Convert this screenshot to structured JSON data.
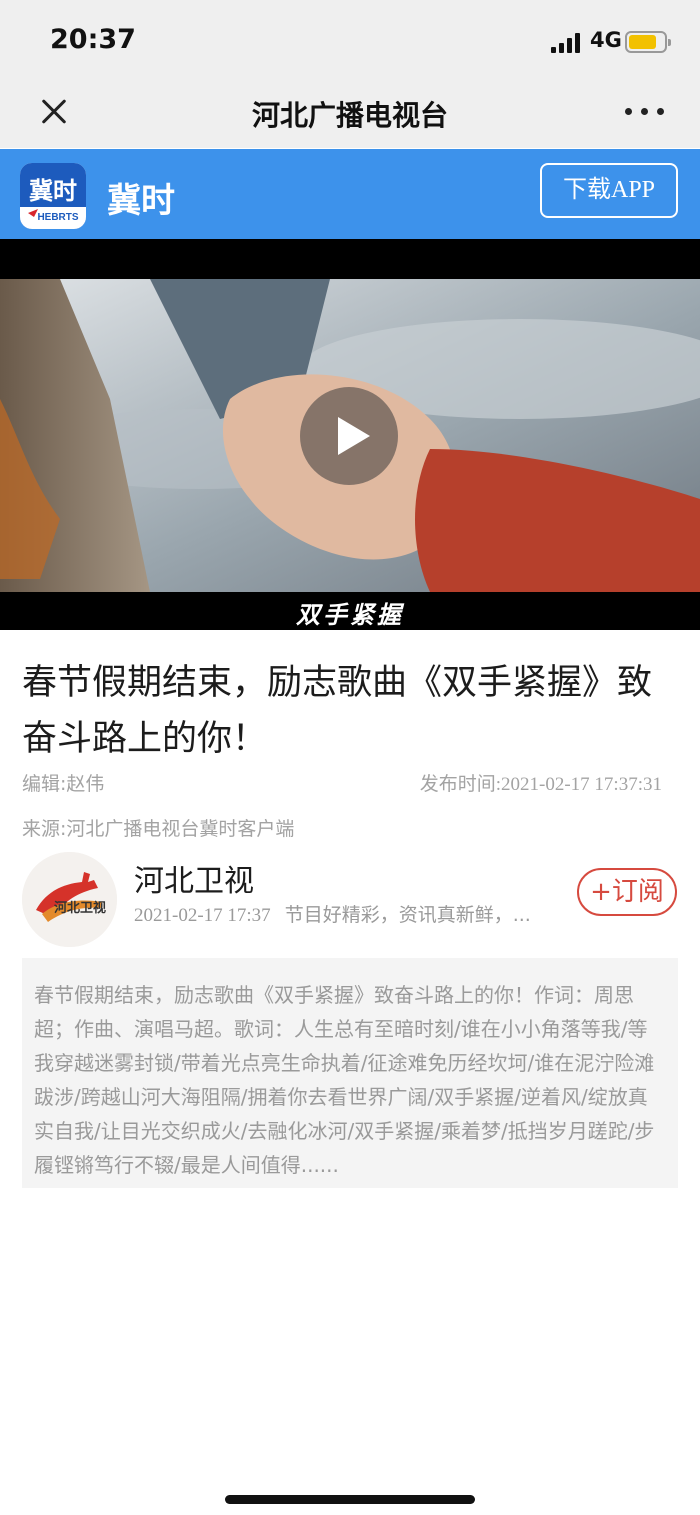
{
  "status_bar": {
    "time": "20:37",
    "network": "4G",
    "battery_level": 0.8,
    "battery_color": "#f2c100"
  },
  "nav_bar": {
    "title": "河北广播电视台",
    "close_icon": "close-icon",
    "more_icon": "more-icon"
  },
  "app_banner": {
    "app_name": "冀时",
    "logo_text": "冀时",
    "logo_subtext": "HEBRTS",
    "download_label": "下载APP",
    "background_color": "#3d92eb"
  },
  "video": {
    "caption": "双手紧握",
    "play_icon": "play-icon"
  },
  "article": {
    "headline": "春节假期结束，励志歌曲《双手紧握》致奋斗路上的你！",
    "editor": "编辑:赵伟",
    "publish_time": "发布时间:2021-02-17 17:37:31",
    "source": "来源:河北广播电视台冀时客户端"
  },
  "channel": {
    "name": "河北卫视",
    "avatar_text": "河北卫视",
    "date": "2021-02-17 17:37",
    "description": "节目好精彩，资讯真新鲜，...",
    "subscribe_label": "+订阅",
    "accent_color": "#d64a3f"
  },
  "summary": {
    "text": "春节假期结束，励志歌曲《双手紧握》致奋斗路上的你！作词：周思超；作曲、演唱马超。歌词：人生总有至暗时刻/谁在小小角落等我/等我穿越迷雾封锁/带着光点亮生命执着/征途难免历经坎坷/谁在泥泞险滩跋涉/跨越山河大海阻隔/拥着你去看世界广阔/双手紧握/逆着风/绽放真实自我/让目光交织成火/去融化冰河/双手紧握/乘着梦/抵挡岁月蹉跎/步履铿锵笃行不辍/最是人间值得......"
  }
}
